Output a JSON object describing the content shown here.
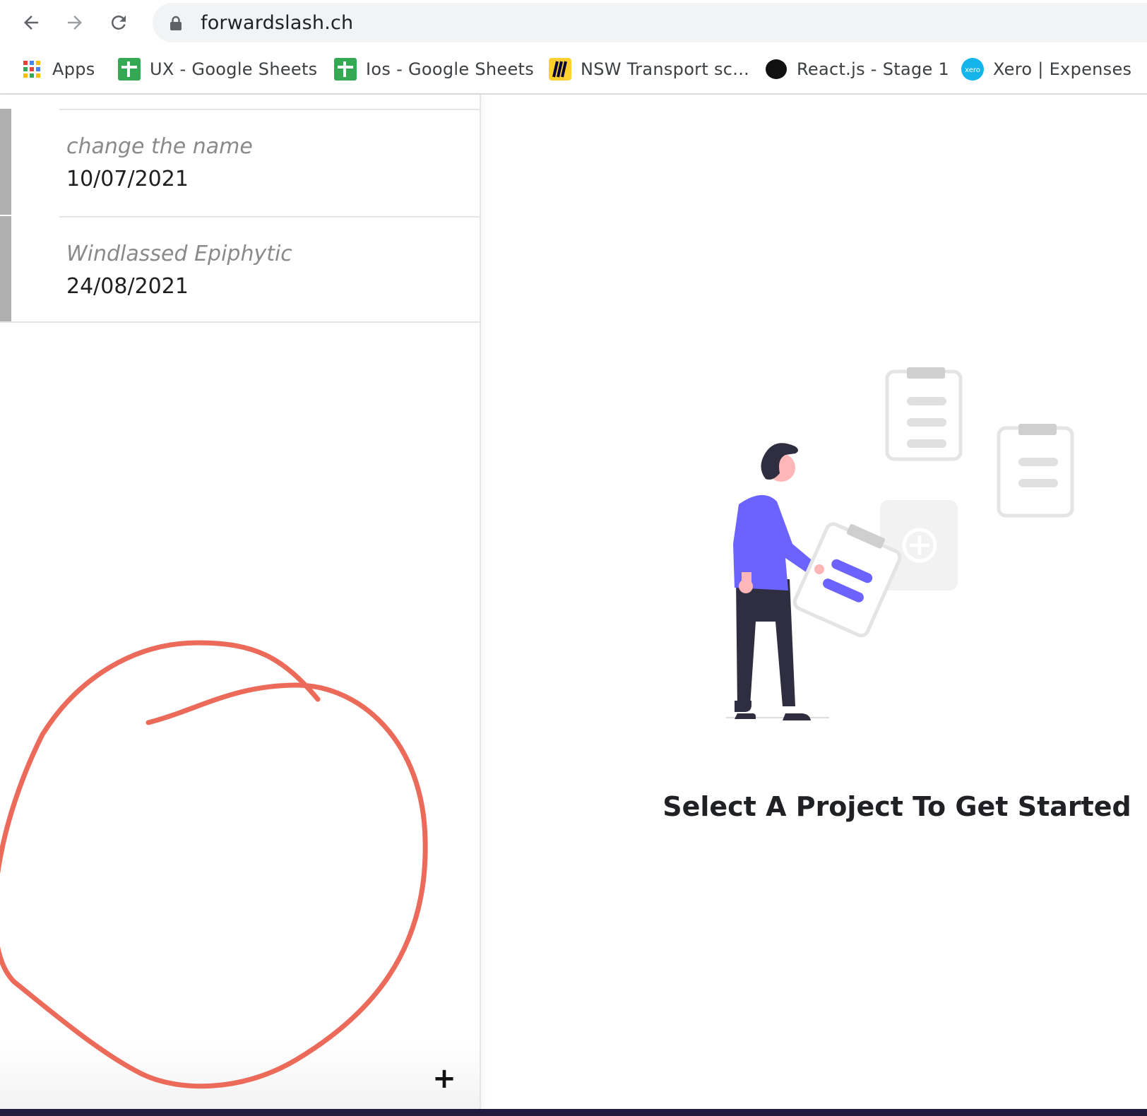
{
  "browser": {
    "url": "forwardslash.ch",
    "bookmarks": [
      {
        "label": "Apps",
        "icon": "apps-grid-icon"
      },
      {
        "label": "UX - Google Sheets",
        "icon": "google-sheets-icon"
      },
      {
        "label": "Ios - Google Sheets",
        "icon": "google-sheets-icon"
      },
      {
        "label": "NSW Transport sc...",
        "icon": "miro-icon"
      },
      {
        "label": "React.js - Stage 1",
        "icon": "black-circle-icon"
      },
      {
        "label": "Xero | Expenses",
        "icon": "xero-icon"
      }
    ]
  },
  "projects": [
    {
      "name": "change the name",
      "date": "10/07/2021"
    },
    {
      "name": "Windlassed Epiphytic",
      "date": "24/08/2021"
    }
  ],
  "add_button": "+",
  "empty_state": {
    "title": "Select A Project To Get Started"
  },
  "colors": {
    "accent": "#6c63ff",
    "annotation": "#ec6a5a",
    "item_bar": "#b0b0b0"
  }
}
